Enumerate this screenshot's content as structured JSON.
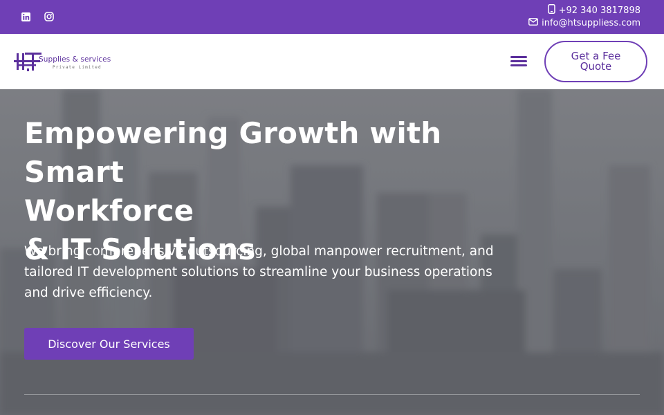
{
  "colors": {
    "brand": "#6f3fb6",
    "brand_dark": "#5b2f9c",
    "white": "#ffffff"
  },
  "topbar": {
    "social": [
      {
        "icon": "linkedin-icon"
      },
      {
        "icon": "instagram-icon"
      }
    ],
    "phone": {
      "icon": "mobile-phone-icon",
      "text": "+92 340 3817898"
    },
    "email": {
      "icon": "envelope-icon",
      "text": "info@htsuppliess.com"
    }
  },
  "header": {
    "logo": {
      "mark": "HT",
      "name": "Supplies & services",
      "sub": "Private Limited"
    },
    "menu_icon": "hamburger-menu-icon",
    "quote_button": "Get a Fee Quote"
  },
  "hero": {
    "title_lines": [
      "Empowering Growth with Smart",
      "Workforce",
      "& IT Solutions"
    ],
    "text": "We bring comprehensive outsourcing, global manpower recruitment, and tailored IT development solutions to streamline your business operations and drive efficiency.",
    "cta": "Discover Our Services"
  }
}
